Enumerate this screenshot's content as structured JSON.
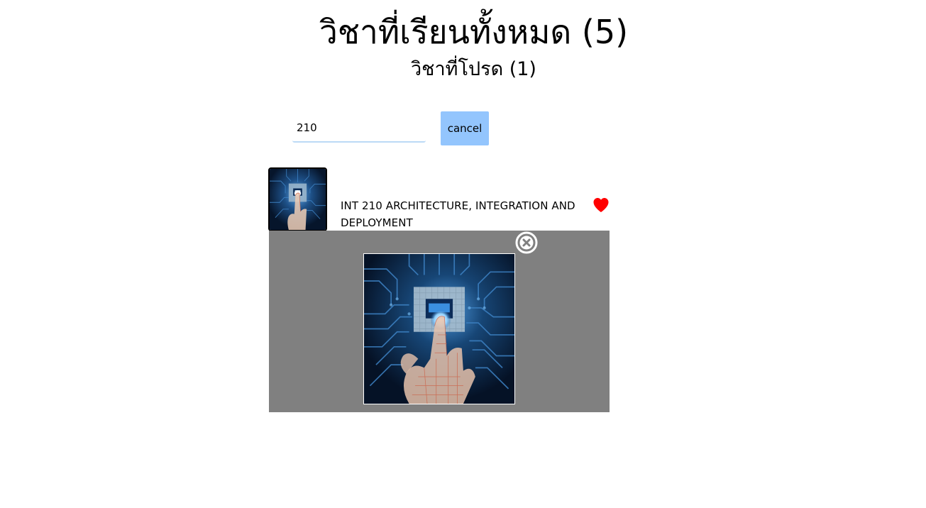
{
  "header": {
    "all_courses_title": "วิชาที่เรียนทั้งหมด (5)",
    "favorite_courses_title": "วิชาที่โปรด (1)"
  },
  "search": {
    "value": "210",
    "cancel_label": "cancel"
  },
  "course": {
    "name": "INT 210 ARCHITECTURE, INTEGRATION AND DEPLOYMENT",
    "favorited": true,
    "image_icon": "circuit-chip-hand-image"
  },
  "preview": {
    "close_icon": "close-circle-icon"
  },
  "colors": {
    "cancel_button_bg": "#93c5fd",
    "input_underline": "#bcdaf6",
    "heart": "#ff0000",
    "overlay_bg": "#808080"
  }
}
